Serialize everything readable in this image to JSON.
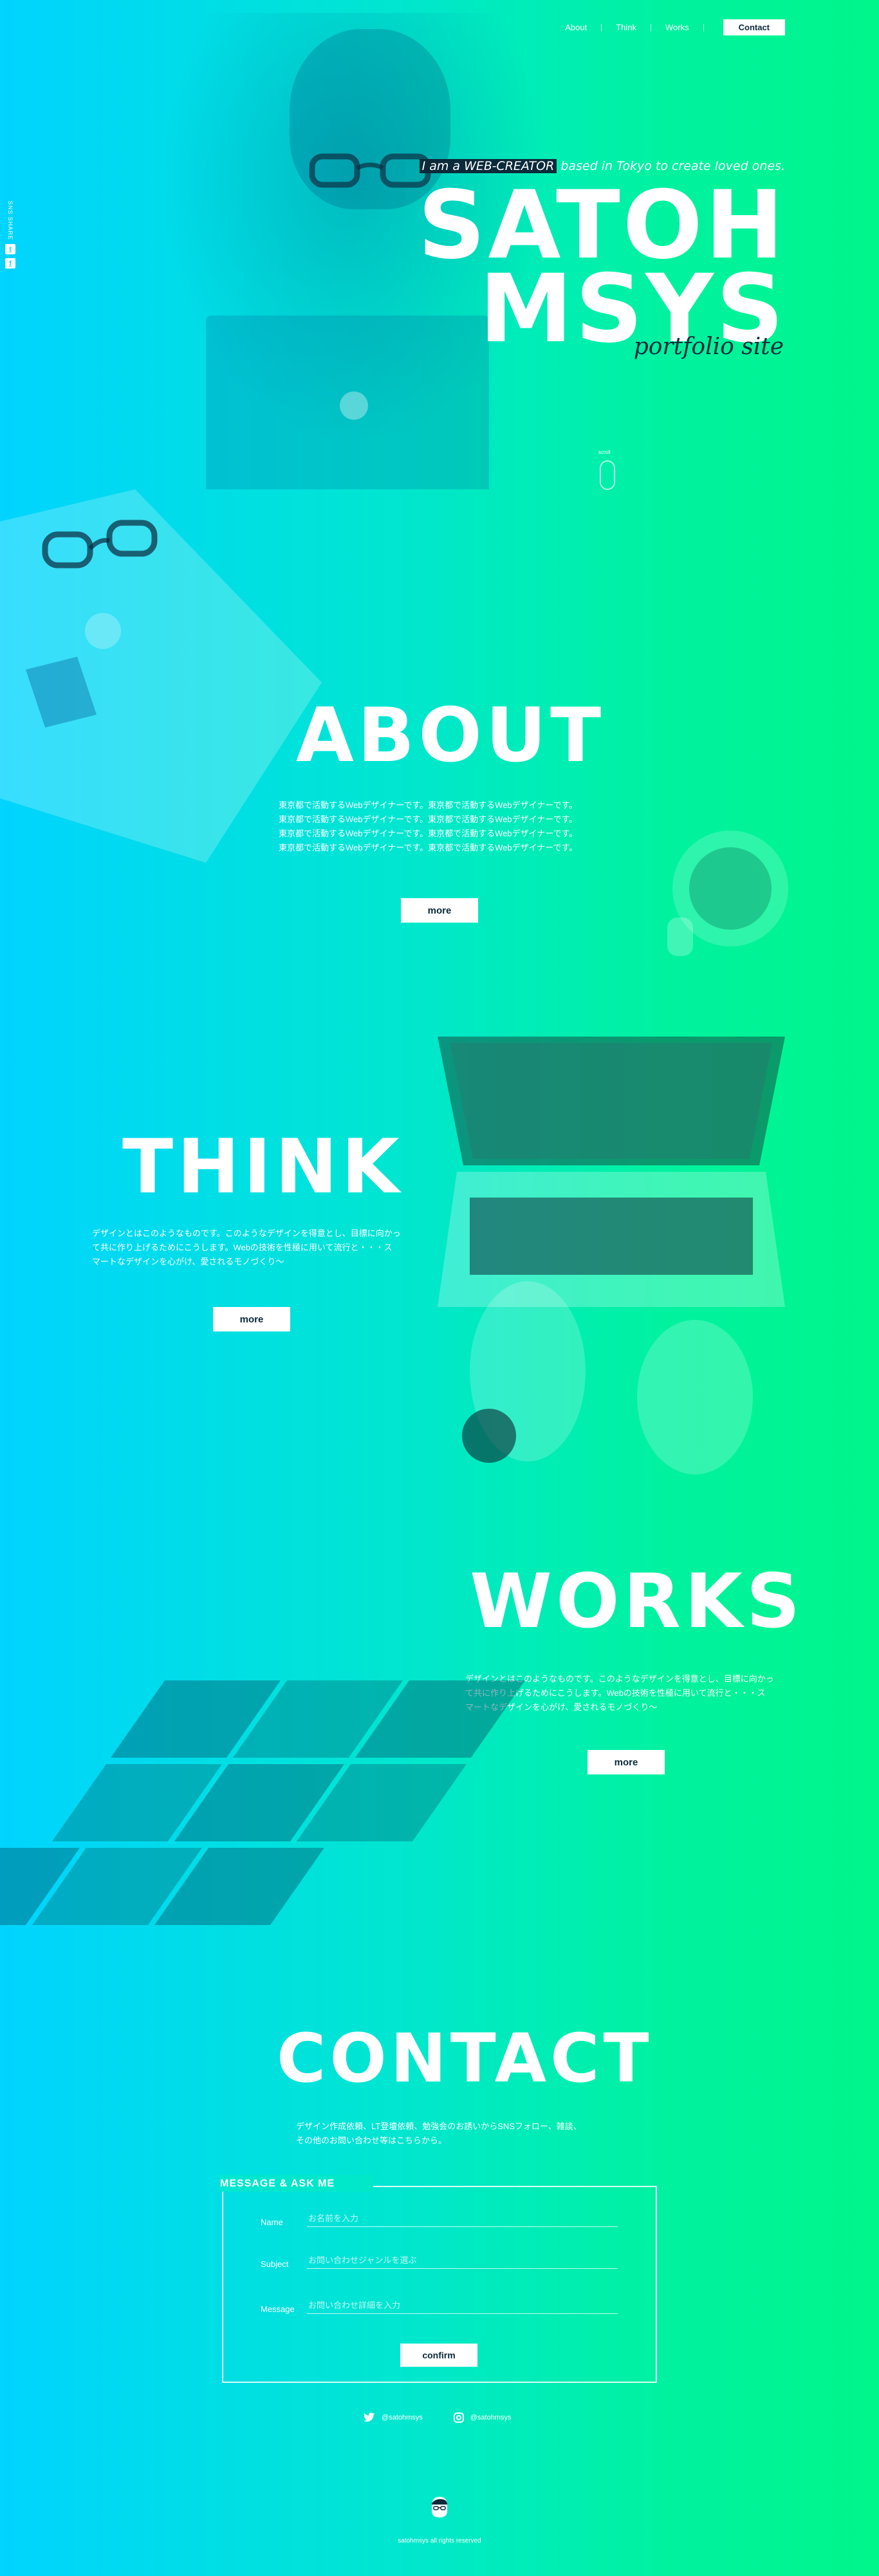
{
  "nav": {
    "about": "About",
    "think": "Think",
    "works": "Works",
    "contact": "Contact"
  },
  "side": {
    "label": "SNS SHARE",
    "twitter_icon": "twitter-icon",
    "facebook_icon": "facebook-icon"
  },
  "hero": {
    "highlight": "I am a WEB-CREATOR",
    "tagline": "based in Tokyo to create loved ones.",
    "title_line1": "SATOH",
    "title_line2": "MSYS",
    "script": "portfolio site",
    "scroll_label": "scroll"
  },
  "about": {
    "title": "ABOUT",
    "lines": [
      "東京都で活動するWebデザイナーです。東京都で活動するWebデザイナーです。",
      "東京都で活動するWebデザイナーです。東京都で活動するWebデザイナーです。",
      "東京都で活動するWebデザイナーです。東京都で活動するWebデザイナーです。",
      "東京都で活動するWebデザイナーです。東京都で活動するWebデザイナーです。"
    ],
    "more": "more"
  },
  "think": {
    "title": "THINK",
    "lines": [
      "デザインとはこのようなものです。このようなデザインを得意とし、目標に向かっ",
      "て共に作り上げるためにこうします。Webの技術を性極に用いて流行と・・・ス",
      "マートなデザインを心がけ、愛されるモノづくり〜"
    ],
    "more": "more"
  },
  "works": {
    "title": "WORKS",
    "lines": [
      "デザインとはこのようなものです。このようなデザインを得意とし、目標に向かっ",
      "て共に作り上げるためにこうします。Webの技術を性極に用いて流行と・・・ス",
      "マートなデザインを心がけ、愛されるモノづくり〜"
    ],
    "more": "more"
  },
  "contact": {
    "title": "CONTACT",
    "lines": [
      "デザイン作成依頼、LT登壇依頼、勉強会のお誘いからSNSフォロー、雑談、",
      "その他のお問い合わせ等はこちらから。"
    ],
    "legend": "MESSAGE & ASK ME",
    "fields": {
      "name_label": "Name",
      "name_placeholder": "お名前を入力",
      "subject_label": "Subject",
      "subject_placeholder": "お問い合わせジャンルを選ぶ",
      "message_label": "Message",
      "message_placeholder": "お問い合わせ詳細を入力"
    },
    "confirm": "confirm"
  },
  "social": {
    "twitter_handle": "@satohmsys",
    "instagram_handle": "@satohmsys"
  },
  "footer": {
    "copyright": "satohmsys all rights reserved"
  },
  "colors": {
    "gradient_left": "#00d4ff",
    "gradient_right": "#00f58a",
    "dark": "#0b2a3a"
  }
}
